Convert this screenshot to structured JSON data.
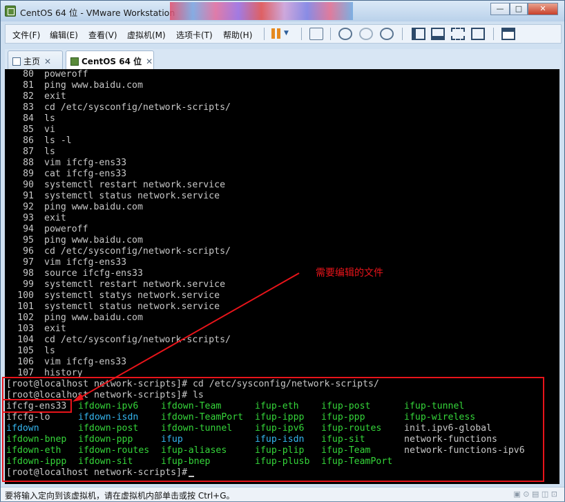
{
  "window": {
    "title": "CentOS 64 位 - VMware Workstation",
    "controls": [
      "—",
      "□",
      "✕"
    ]
  },
  "menu": {
    "items": [
      "文件(F)",
      "编辑(E)",
      "查看(V)",
      "虚拟机(M)",
      "选项卡(T)",
      "帮助(H)"
    ]
  },
  "tabs": [
    {
      "label": "主页",
      "active": false
    },
    {
      "label": "CentOS 64 位",
      "active": true
    }
  ],
  "terminal": {
    "history": [
      {
        "n": "80",
        "cmd": "poweroff"
      },
      {
        "n": "81",
        "cmd": "ping www.baidu.com"
      },
      {
        "n": "82",
        "cmd": "exit"
      },
      {
        "n": "83",
        "cmd": "cd /etc/sysconfig/network-scripts/"
      },
      {
        "n": "84",
        "cmd": "ls"
      },
      {
        "n": "85",
        "cmd": "vi"
      },
      {
        "n": "86",
        "cmd": "ls -l"
      },
      {
        "n": "87",
        "cmd": "ls"
      },
      {
        "n": "88",
        "cmd": "vim ifcfg-ens33"
      },
      {
        "n": "89",
        "cmd": "cat ifcfg-ens33"
      },
      {
        "n": "90",
        "cmd": "systemctl restart network.service"
      },
      {
        "n": "91",
        "cmd": "systemctl status network.service"
      },
      {
        "n": "92",
        "cmd": "ping www.baidu.com"
      },
      {
        "n": "93",
        "cmd": "exit"
      },
      {
        "n": "94",
        "cmd": "poweroff"
      },
      {
        "n": "95",
        "cmd": "ping www.baidu.com"
      },
      {
        "n": "96",
        "cmd": "cd /etc/sysconfig/network-scripts/"
      },
      {
        "n": "97",
        "cmd": "vim ifcfg-ens33"
      },
      {
        "n": "98",
        "cmd": "source ifcfg-ens33"
      },
      {
        "n": "99",
        "cmd": "systemctl restart network.service"
      },
      {
        "n": "100",
        "cmd": "systemctl statys network.service"
      },
      {
        "n": "101",
        "cmd": "systemctl status network.service"
      },
      {
        "n": "102",
        "cmd": "ping www.baidu.com"
      },
      {
        "n": "103",
        "cmd": "exit"
      },
      {
        "n": "104",
        "cmd": "cd /etc/sysconfig/network-scripts/"
      },
      {
        "n": "105",
        "cmd": "ls"
      },
      {
        "n": "106",
        "cmd": "vim ifcfg-ens33"
      },
      {
        "n": "107",
        "cmd": "history"
      }
    ],
    "prompt_lines": [
      "[root@localhost network-scripts]# cd /etc/sysconfig/network-scripts/",
      "[root@localhost network-scripts]# ls"
    ],
    "ls_rows": [
      [
        {
          "t": "ifcfg-ens33",
          "c": "#c8c8c8"
        },
        {
          "t": "ifdown-ipv6",
          "c": "#35d63a"
        },
        {
          "t": "ifdown-Team",
          "c": "#35d63a"
        },
        {
          "t": "ifup-eth",
          "c": "#35d63a"
        },
        {
          "t": "ifup-post",
          "c": "#35d63a"
        },
        {
          "t": "ifup-tunnel",
          "c": "#35d63a"
        }
      ],
      [
        {
          "t": "ifcfg-lo",
          "c": "#c8c8c8"
        },
        {
          "t": "ifdown-isdn",
          "c": "#35b6ef"
        },
        {
          "t": "ifdown-TeamPort",
          "c": "#35d63a"
        },
        {
          "t": "ifup-ippp",
          "c": "#35d63a"
        },
        {
          "t": "ifup-ppp",
          "c": "#35d63a"
        },
        {
          "t": "ifup-wireless",
          "c": "#35d63a"
        }
      ],
      [
        {
          "t": "ifdown",
          "c": "#35b6ef"
        },
        {
          "t": "ifdown-post",
          "c": "#35d63a"
        },
        {
          "t": "ifdown-tunnel",
          "c": "#35d63a"
        },
        {
          "t": "ifup-ipv6",
          "c": "#35d63a"
        },
        {
          "t": "ifup-routes",
          "c": "#35d63a"
        },
        {
          "t": "init.ipv6-global",
          "c": "#c8c8c8"
        }
      ],
      [
        {
          "t": "ifdown-bnep",
          "c": "#35d63a"
        },
        {
          "t": "ifdown-ppp",
          "c": "#35d63a"
        },
        {
          "t": "ifup",
          "c": "#35b6ef"
        },
        {
          "t": "ifup-isdn",
          "c": "#35b6ef"
        },
        {
          "t": "ifup-sit",
          "c": "#35d63a"
        },
        {
          "t": "network-functions",
          "c": "#c8c8c8"
        }
      ],
      [
        {
          "t": "ifdown-eth",
          "c": "#35d63a"
        },
        {
          "t": "ifdown-routes",
          "c": "#35d63a"
        },
        {
          "t": "ifup-aliases",
          "c": "#35d63a"
        },
        {
          "t": "ifup-plip",
          "c": "#35d63a"
        },
        {
          "t": "ifup-Team",
          "c": "#35d63a"
        },
        {
          "t": "network-functions-ipv6",
          "c": "#c8c8c8"
        }
      ],
      [
        {
          "t": "ifdown-ippp",
          "c": "#35d63a"
        },
        {
          "t": "ifdown-sit",
          "c": "#35d63a"
        },
        {
          "t": "ifup-bnep",
          "c": "#35d63a"
        },
        {
          "t": "ifup-plusb",
          "c": "#35d63a"
        },
        {
          "t": "ifup-TeamPort",
          "c": "#35d63a"
        }
      ]
    ],
    "final_prompt": "[root@localhost network-scripts]#"
  },
  "annotation": {
    "text": "需要编辑的文件",
    "color": "#e8141a"
  },
  "status": {
    "text": "要将输入定向到该虚拟机，请在虚拟机内部单击或按 Ctrl+G。"
  }
}
